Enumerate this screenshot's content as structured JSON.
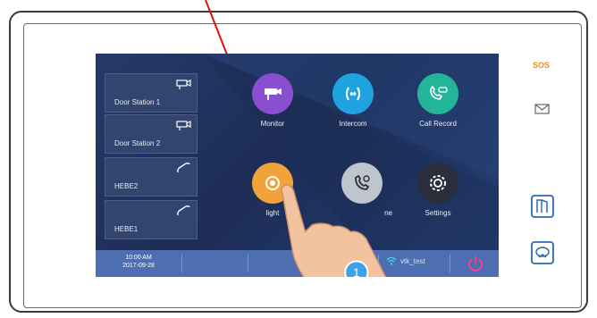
{
  "sources": [
    {
      "label": "Door Station 1",
      "icon": "camera-icon"
    },
    {
      "label": "Door Station 2",
      "icon": "camera-icon"
    },
    {
      "label": "HEBE2",
      "icon": "handset-icon"
    },
    {
      "label": "HEBE1",
      "icon": "handset-icon"
    }
  ],
  "tiles": [
    {
      "label": "Monitor",
      "icon": "cctv-camera-icon",
      "color": "#8a4fd0"
    },
    {
      "label": "Intercom",
      "icon": "intercom-arrows-icon",
      "color": "#1ea3e0"
    },
    {
      "label": "Call Record",
      "icon": "phone-voicemail-icon",
      "color": "#23b59a"
    },
    {
      "label": "light",
      "icon": "light-icon",
      "color": "#f2a23a"
    },
    {
      "label": "ne",
      "icon": "phone-settings-icon",
      "color": "#bfc5cf"
    },
    {
      "label": "Settings",
      "icon": "gear-icon",
      "color": "#2a2f3b"
    }
  ],
  "status_bar": {
    "time": "10:00 AM",
    "date": "2017-09-28",
    "wifi_name": "vtk_test",
    "wifi_icon": "wifi-icon",
    "power_icon": "power-icon"
  },
  "side_panel": {
    "sos_label": "SOS",
    "message_icon": "envelope-icon",
    "unlock_icon": "door-icon",
    "monitor_icon": "monitor-icon"
  },
  "annotation": {
    "step_badge": "1",
    "arrow_color": "#e01010"
  }
}
